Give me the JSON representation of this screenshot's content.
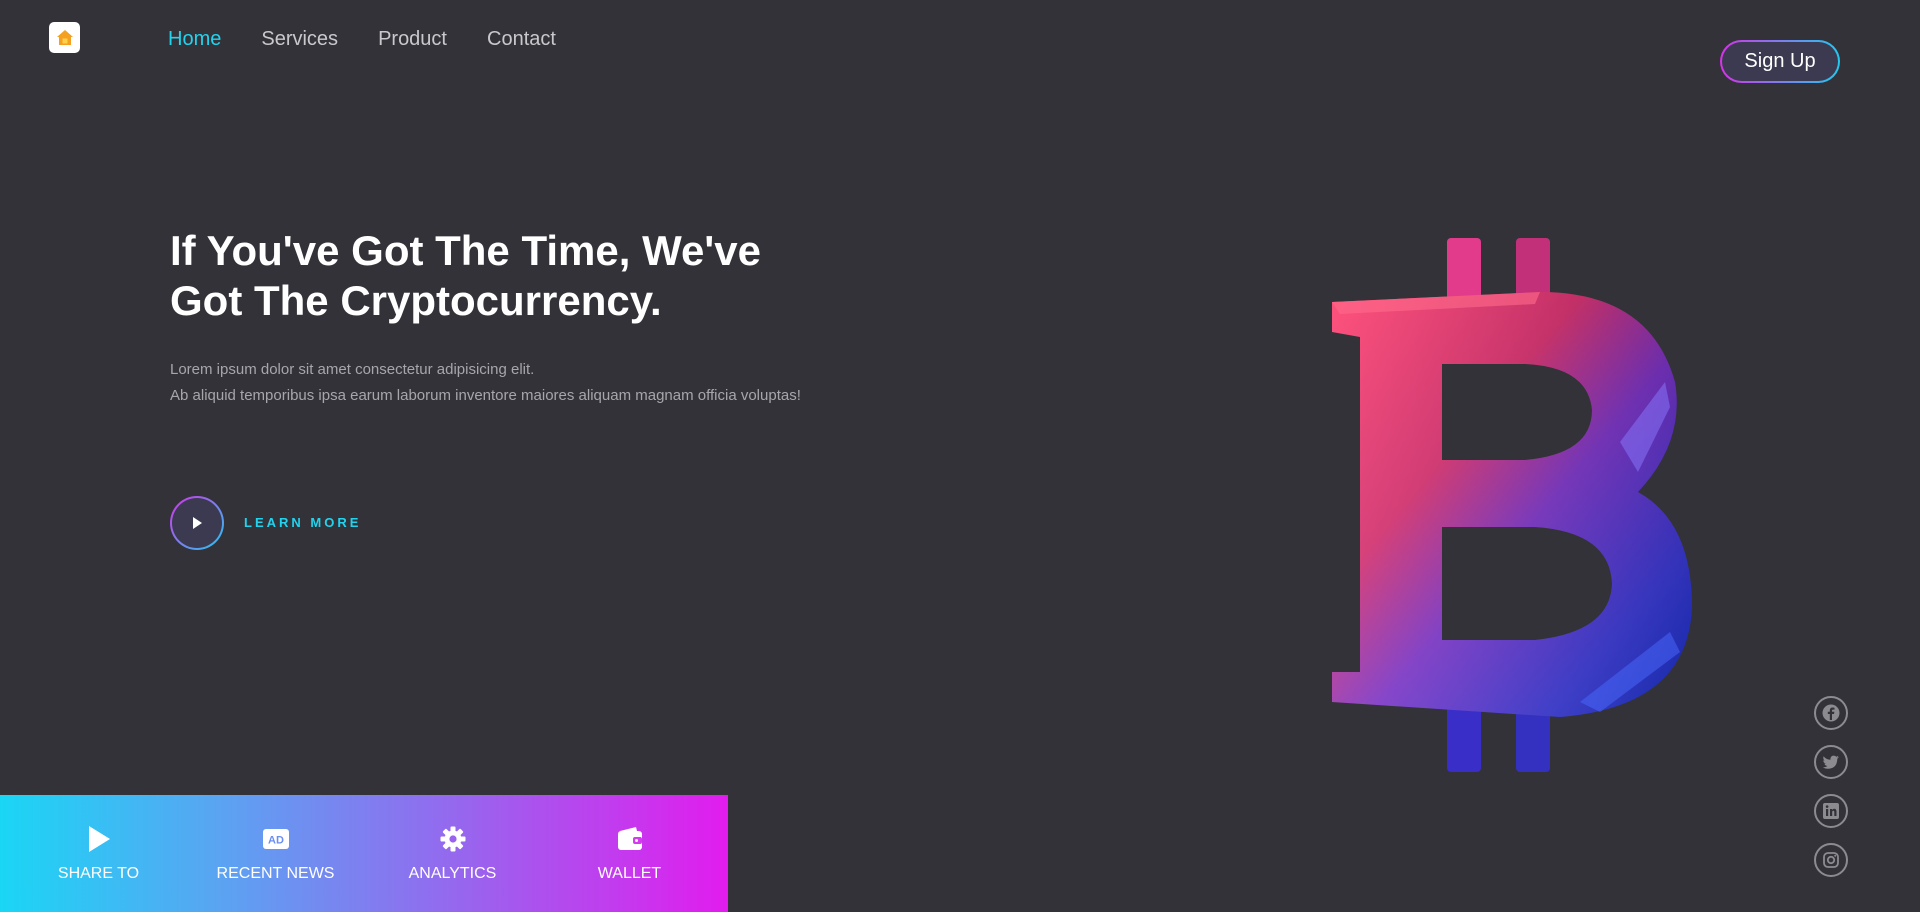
{
  "nav": {
    "items": [
      {
        "label": "Home"
      },
      {
        "label": "Services"
      },
      {
        "label": "Product"
      },
      {
        "label": "Contact"
      }
    ],
    "active": "Home",
    "signup_label": "Sign Up"
  },
  "hero": {
    "title_line1": "If You've Got The Time, We've",
    "title_line2": "Got The Cryptocurrency.",
    "subtitle_line1": "Lorem ipsum dolor sit amet consectetur adipisicing elit.",
    "subtitle_line2": "Ab aliquid temporibus ipsa earum laborum inventore maiores aliquam magnam officia voluptas!",
    "cta_label": "LEARN MORE"
  },
  "social": [
    {
      "icon": "facebook-icon"
    },
    {
      "icon": "twitter-icon"
    },
    {
      "icon": "linkedin-icon"
    },
    {
      "icon": "instagram-icon"
    }
  ],
  "bottom_bar": {
    "items": [
      {
        "label": "SHARE TO",
        "icon": "play-icon"
      },
      {
        "label": "RECENT NEWS",
        "icon": "ad-icon",
        "icon_text": "AD"
      },
      {
        "label": "ANALYTICS",
        "icon": "gear-icon"
      },
      {
        "label": "WALLET",
        "icon": "wallet-icon"
      }
    ]
  },
  "colors": {
    "background": "#323238",
    "accent": "#22d3ee",
    "gradient_start": "#1ad6f5",
    "gradient_end": "#e21cee"
  }
}
